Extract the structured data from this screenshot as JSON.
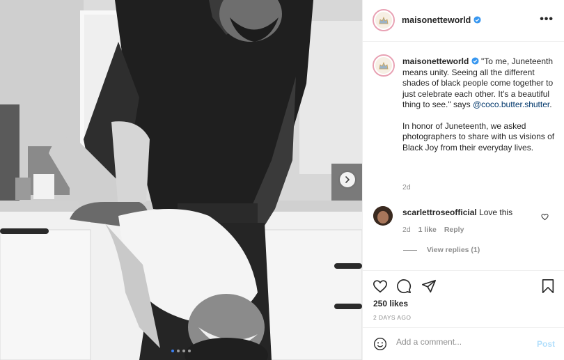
{
  "post": {
    "username": "maisonetteworld",
    "verified": true,
    "more_icon": "more-horizontal-icon",
    "photo_alt_icons": [
      "chevron-right-icon"
    ],
    "carousel": {
      "count": 4,
      "active_index": 0
    }
  },
  "caption": {
    "username": "maisonetteworld",
    "text_1": "\"To me, Juneteenth means unity. Seeing all the different shades of black people come together to just celebrate each other. It's a beautiful thing to see.\" says ",
    "mention": "@coco.butter.shutter",
    "text_1_end": ".",
    "text_2": "In honor of Juneteenth, we asked photographers to share with us visions of Black Joy from their everyday lives.",
    "timestamp": "2d"
  },
  "comment": {
    "username": "scarlettroseofficial",
    "text": "Love this",
    "time": "2d",
    "likes": "1 like",
    "reply_label": "Reply",
    "view_replies": "View replies (1)"
  },
  "actions": {
    "likes": "250 likes",
    "posted_ago": "2 DAYS AGO"
  },
  "add_comment": {
    "placeholder": "Add a comment...",
    "post_label": "Post"
  },
  "colors": {
    "accent": "#0095f6",
    "verified": "#3897f0",
    "post_disabled": "#b2dffc",
    "mention": "#00376b"
  }
}
